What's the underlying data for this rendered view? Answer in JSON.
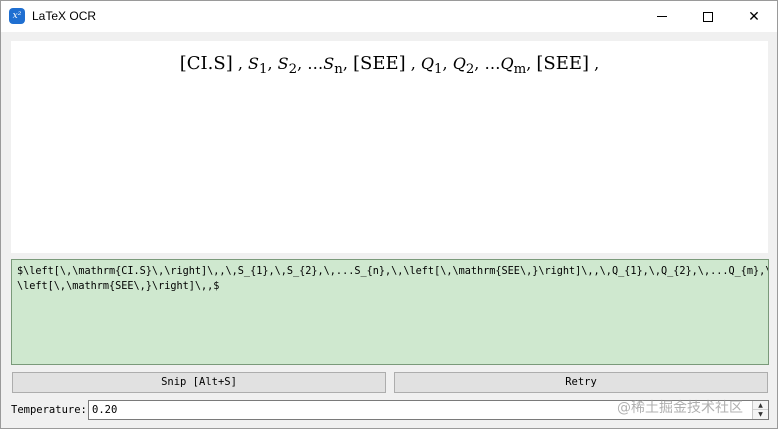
{
  "window": {
    "title": "LaTeX OCR",
    "icon": "latex-ocr-app-icon",
    "icon_glyph": "x²",
    "controls": {
      "minimize": "minimize-icon",
      "maximize": "maximize-icon",
      "close": "close-icon",
      "close_glyph": "✕"
    }
  },
  "preview": {
    "formula": {
      "cls": "[CI.S]",
      "s1": "S",
      "s1_sub": "1",
      "s2": "S",
      "s2_sub": "2",
      "dots1": "…",
      "sn": "S",
      "sn_sub": "n",
      "sep1": "[SEE]",
      "q1": "Q",
      "q1_sub": "1",
      "q2": "Q",
      "q2_sub": "2",
      "dots2": "…",
      "qm": "Q",
      "qm_sub": "m",
      "sep2": "[SEE]"
    }
  },
  "latex_output": {
    "line1": "$\\left[\\,\\mathrm{CI.S}\\,\\right]\\,,\\,S_{1},\\,S_{2},\\,...S_{n},\\,\\left[\\,\\mathrm{SEE\\,}\\right]\\,,\\,Q_{1},\\,Q_{2},\\,...Q_{m},\\,",
    "line2": "\\left[\\,\\mathrm{SEE\\,}\\right]\\,,$"
  },
  "buttons": {
    "snip": "Snip [Alt+S]",
    "retry": "Retry"
  },
  "temperature": {
    "label": "Temperature:",
    "value": "0.20",
    "spin_up": "▲",
    "spin_down": "▼"
  },
  "watermark": "@稀土掘金技术社区",
  "colors": {
    "latex_bg": "#cfe8cf",
    "app_icon": "#1f6fd1"
  }
}
